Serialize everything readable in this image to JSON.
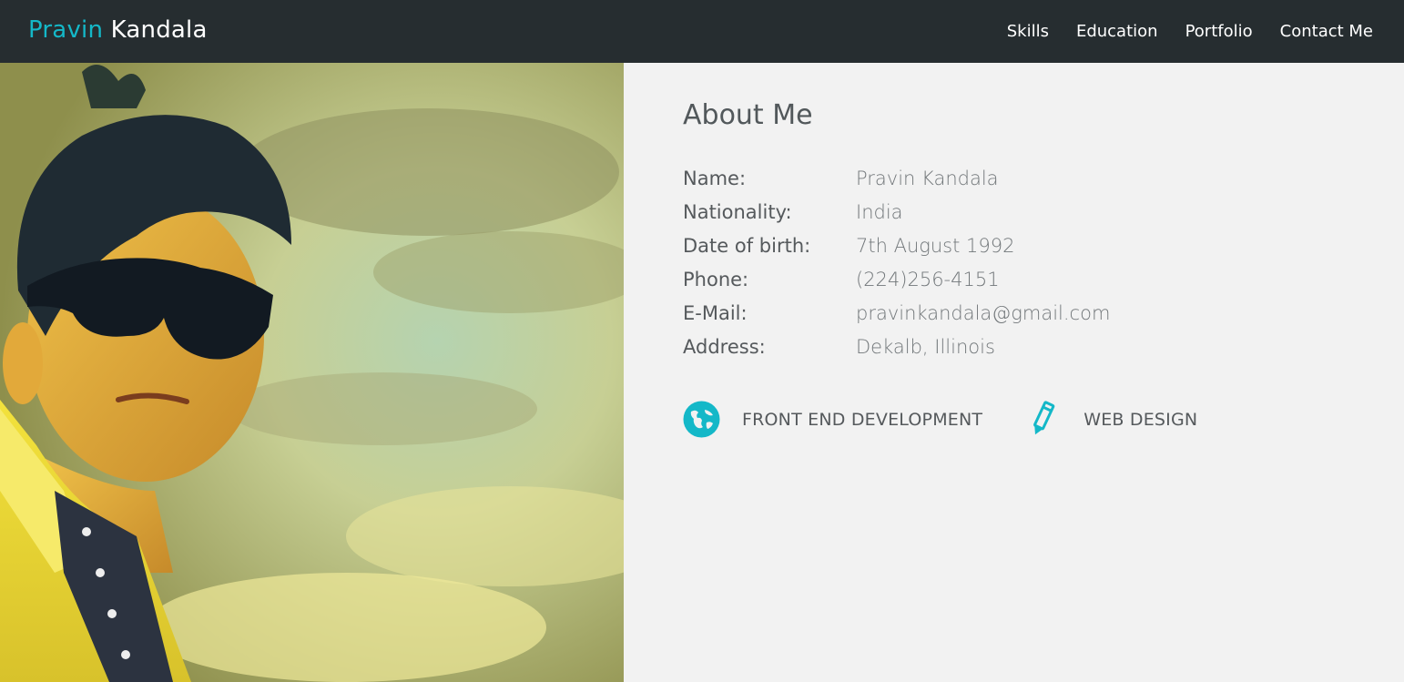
{
  "brand": {
    "first": "Pravin",
    "last": "Kandala"
  },
  "nav": [
    {
      "label": "Skills"
    },
    {
      "label": "Education"
    },
    {
      "label": "Portfolio"
    },
    {
      "label": "Contact Me"
    }
  ],
  "about": {
    "title": "About Me",
    "rows": [
      {
        "label": "Name:",
        "value": "Pravin Kandala"
      },
      {
        "label": "Nationality:",
        "value": "India"
      },
      {
        "label": "Date of birth:",
        "value": "7th August 1992"
      },
      {
        "label": "Phone:",
        "value": "(224)256-4151"
      },
      {
        "label": "E-Mail:",
        "value": "pravinkandala@gmail.com"
      },
      {
        "label": "Address:",
        "value": "Dekalb, Illinois"
      }
    ]
  },
  "skills": [
    {
      "label": "FRONT END DEVELOPMENT",
      "icon": "globe-icon"
    },
    {
      "label": "WEB DESIGN",
      "icon": "pencil-icon"
    }
  ],
  "colors": {
    "accent": "#14b8c8",
    "topbar": "#262d30",
    "background": "#f2f2f2"
  }
}
